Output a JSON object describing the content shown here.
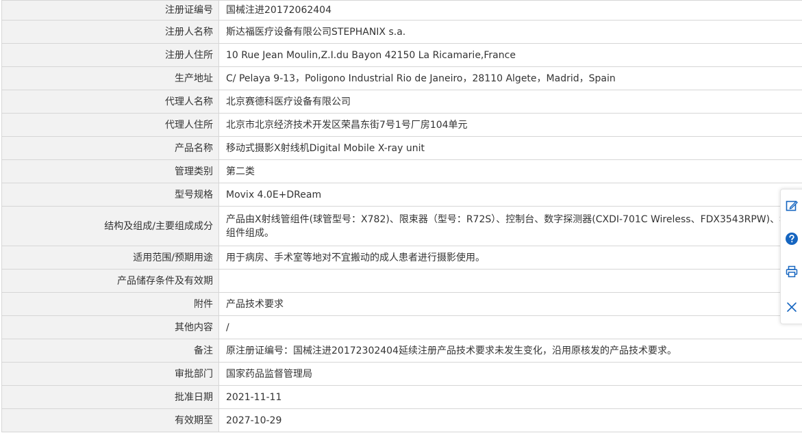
{
  "rows": [
    {
      "label": "注册证编号",
      "value": "国械注进20172062404"
    },
    {
      "label": "注册人名称",
      "value": "斯达福医疗设备有限公司STEPHANIX s.a."
    },
    {
      "label": "注册人住所",
      "value": "10 Rue Jean Moulin,Z.I.du Bayon 42150 La Ricamarie,France"
    },
    {
      "label": "生产地址",
      "value": "C/ Pelaya 9-13，Poligono Industrial Rio de Janeiro，28110 Algete，Madrid，Spain"
    },
    {
      "label": "代理人名称",
      "value": "北京赛德科医疗设备有限公司"
    },
    {
      "label": "代理人住所",
      "value": "北京市北京经济技术开发区荣昌东街7号1号厂房104单元"
    },
    {
      "label": "产品名称",
      "value": "移动式摄影X射线机Digital Mobile X-ray unit"
    },
    {
      "label": "管理类别",
      "value": "第二类"
    },
    {
      "label": "型号规格",
      "value": "Movix 4.0E+DReam"
    },
    {
      "label": "结构及组成/主要组成成分",
      "value": "产品由X射线管组件(球管型号：X782)、限束器（型号：R72S）、控制台、数字探测器(CXDI-701C Wireless、FDX3543RPW)、移",
      "value2": "组件组成。"
    },
    {
      "label": "适用范围/预期用途",
      "value": "用于病房、手术室等地对不宜搬动的成人患者进行摄影使用。"
    },
    {
      "label": "产品储存条件及有效期",
      "value": ""
    },
    {
      "label": "附件",
      "value": "产品技术要求"
    },
    {
      "label": "其他内容",
      "value": "/"
    },
    {
      "label": "备注",
      "value": "原注册证编号：国械注进20172302404延续注册产品技术要求未发生变化，沿用原核发的产品技术要求。"
    },
    {
      "label": "审批部门",
      "value": "国家药品监督管理局"
    },
    {
      "label": "批准日期",
      "value": "2021-11-11"
    },
    {
      "label": "有效期至",
      "value": "2027-10-29"
    }
  ],
  "sidebar": {
    "icons": [
      "edit-icon",
      "help-icon",
      "print-icon",
      "close-icon"
    ],
    "accent": "#1565c0"
  }
}
